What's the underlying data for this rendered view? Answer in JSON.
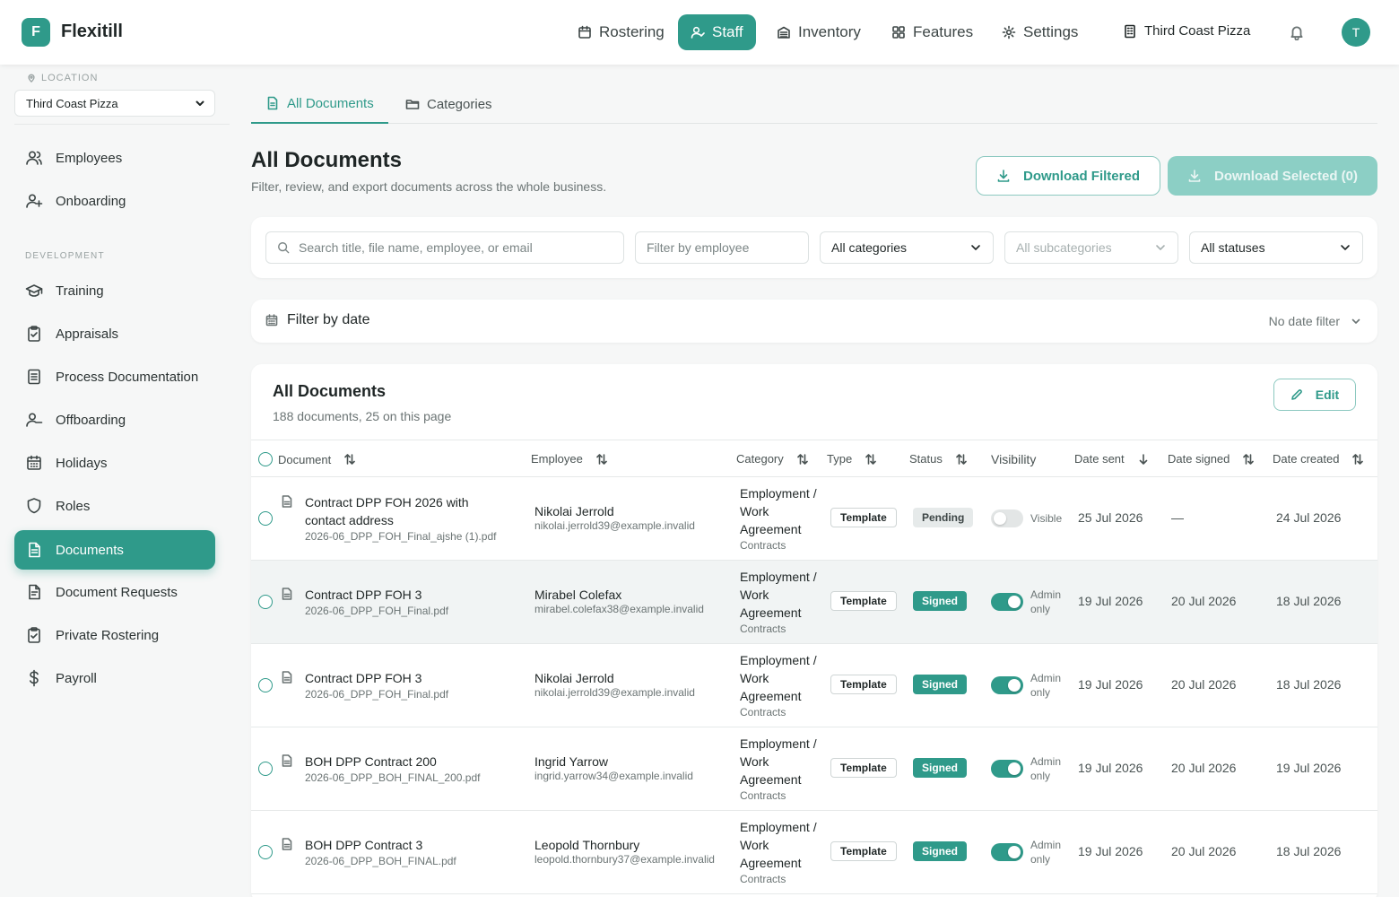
{
  "app": {
    "logo_letter": "F",
    "name": "Flexitill"
  },
  "topnav": {
    "items": [
      {
        "label": "Rostering",
        "icon": "calendar-icon"
      },
      {
        "label": "Staff",
        "icon": "staff-icon"
      },
      {
        "label": "Inventory",
        "icon": "inventory-icon"
      },
      {
        "label": "Features",
        "icon": "grid-icon"
      },
      {
        "label": "Settings",
        "icon": "gear-icon"
      }
    ],
    "org": "Third Coast Pizza",
    "avatar": "T"
  },
  "sidebar": {
    "location_label": "LOCATION",
    "location_value": "Third Coast Pizza",
    "section_development": "DEVELOPMENT",
    "items": [
      {
        "label": "Employees"
      },
      {
        "label": "Onboarding"
      },
      {
        "label": "Training"
      },
      {
        "label": "Appraisals"
      },
      {
        "label": "Process Documentation"
      },
      {
        "label": "Offboarding"
      },
      {
        "label": "Holidays"
      },
      {
        "label": "Roles"
      },
      {
        "label": "Documents"
      },
      {
        "label": "Document Requests"
      },
      {
        "label": "Private Rostering"
      },
      {
        "label": "Payroll"
      }
    ]
  },
  "tabs": [
    {
      "label": "All Documents"
    },
    {
      "label": "Categories"
    }
  ],
  "header": {
    "title": "All Documents",
    "subtitle": "Filter, review, and export documents across the whole business.",
    "download_filtered": "Download Filtered",
    "download_selected": "Download Selected (0)"
  },
  "filters": {
    "search_placeholder": "Search title, file name, employee, or email",
    "employee_placeholder": "Filter by employee",
    "category": "All categories",
    "subcategory": "All subcategories",
    "status": "All statuses"
  },
  "date_filter": {
    "label": "Filter by date",
    "value": "No date filter"
  },
  "table": {
    "title": "All Documents",
    "summary": "188 documents, 25 on this page",
    "edit_label": "Edit",
    "columns": {
      "document": "Document",
      "employee": "Employee",
      "category": "Category",
      "type": "Type",
      "status": "Status",
      "visibility": "Visibility",
      "date_sent": "Date sent",
      "date_signed": "Date signed",
      "date_created": "Date created"
    },
    "rows": [
      {
        "title": "Contract DPP FOH 2026 with contact address",
        "file": "2026-06_DPP_FOH_Final_ajshe (1).pdf",
        "employee": "Nikolai Jerrold",
        "email": "nikolai.jerrold39@example.invalid",
        "category": "Employment / Work Agreement",
        "subcategory": "Contracts",
        "type": "Template",
        "status": "Pending",
        "visibility": "Visible",
        "date_sent": "25 Jul 2026",
        "date_signed": "—",
        "date_created": "24 Jul 2026"
      },
      {
        "title": "Contract DPP FOH 3",
        "file": "2026-06_DPP_FOH_Final.pdf",
        "employee": "Mirabel Colefax",
        "email": "mirabel.colefax38@example.invalid",
        "category": "Employment / Work Agreement",
        "subcategory": "Contracts",
        "type": "Template",
        "status": "Signed",
        "visibility": "Admin only",
        "date_sent": "19 Jul 2026",
        "date_signed": "20 Jul 2026",
        "date_created": "18 Jul 2026"
      },
      {
        "title": "Contract DPP FOH 3",
        "file": "2026-06_DPP_FOH_Final.pdf",
        "employee": "Nikolai Jerrold",
        "email": "nikolai.jerrold39@example.invalid",
        "category": "Employment / Work Agreement",
        "subcategory": "Contracts",
        "type": "Template",
        "status": "Signed",
        "visibility": "Admin only",
        "date_sent": "19 Jul 2026",
        "date_signed": "20 Jul 2026",
        "date_created": "18 Jul 2026"
      },
      {
        "title": "BOH DPP Contract 200",
        "file": "2026-06_DPP_BOH_FINAL_200.pdf",
        "employee": "Ingrid Yarrow",
        "email": "ingrid.yarrow34@example.invalid",
        "category": "Employment / Work Agreement",
        "subcategory": "Contracts",
        "type": "Template",
        "status": "Signed",
        "visibility": "Admin only",
        "date_sent": "19 Jul 2026",
        "date_signed": "20 Jul 2026",
        "date_created": "19 Jul 2026"
      },
      {
        "title": "BOH DPP Contract 3",
        "file": "2026-06_DPP_BOH_FINAL.pdf",
        "employee": "Leopold Thornbury",
        "email": "leopold.thornbury37@example.invalid",
        "category": "Employment / Work Agreement",
        "subcategory": "Contracts",
        "type": "Template",
        "status": "Signed",
        "visibility": "Admin only",
        "date_sent": "19 Jul 2026",
        "date_signed": "20 Jul 2026",
        "date_created": "18 Jul 2026"
      }
    ]
  },
  "colors": {
    "accent": "#2f9a8a",
    "accent_light": "#8ccfc5"
  }
}
